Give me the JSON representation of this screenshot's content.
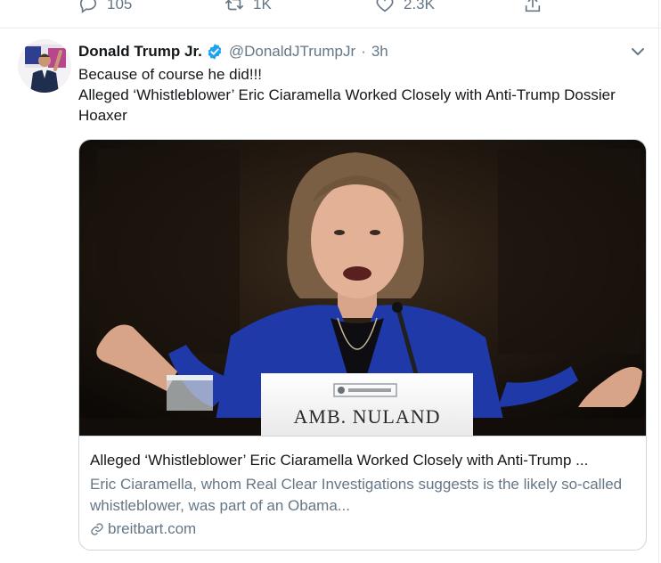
{
  "prev_tweet": {
    "reply_count": "105",
    "retweet_count": "1K",
    "like_count": "2.3K",
    "icons": [
      "reply-icon",
      "retweet-icon",
      "like-icon",
      "share-icon"
    ]
  },
  "tweet": {
    "author_name": "Donald Trump Jr.",
    "handle": "@DonaldJTrumpJr",
    "separator": "·",
    "time": "3h",
    "text_line1": "Because of course he did!!!",
    "text_line2": "Alleged ‘Whistleblower’ Eric Ciaramella Worked Closely with Anti-Trump Dossier Hoaxer",
    "card": {
      "nameplate": "AMB. NULAND",
      "title": "Alleged ‘Whistleblower’ Eric Ciaramella Worked Closely with Anti-Trump ...",
      "description": "Eric Ciaramella, whom Real Clear Investigations suggests is the likely so-called whistleblower, was part of an Obama...",
      "domain": "breitbart.com"
    }
  },
  "colors": {
    "text_primary": "#14171a",
    "text_secondary": "#657786",
    "verified_blue": "#1da1f2",
    "border": "#ccd6dd",
    "blazer_blue": "#1f3aa8"
  }
}
